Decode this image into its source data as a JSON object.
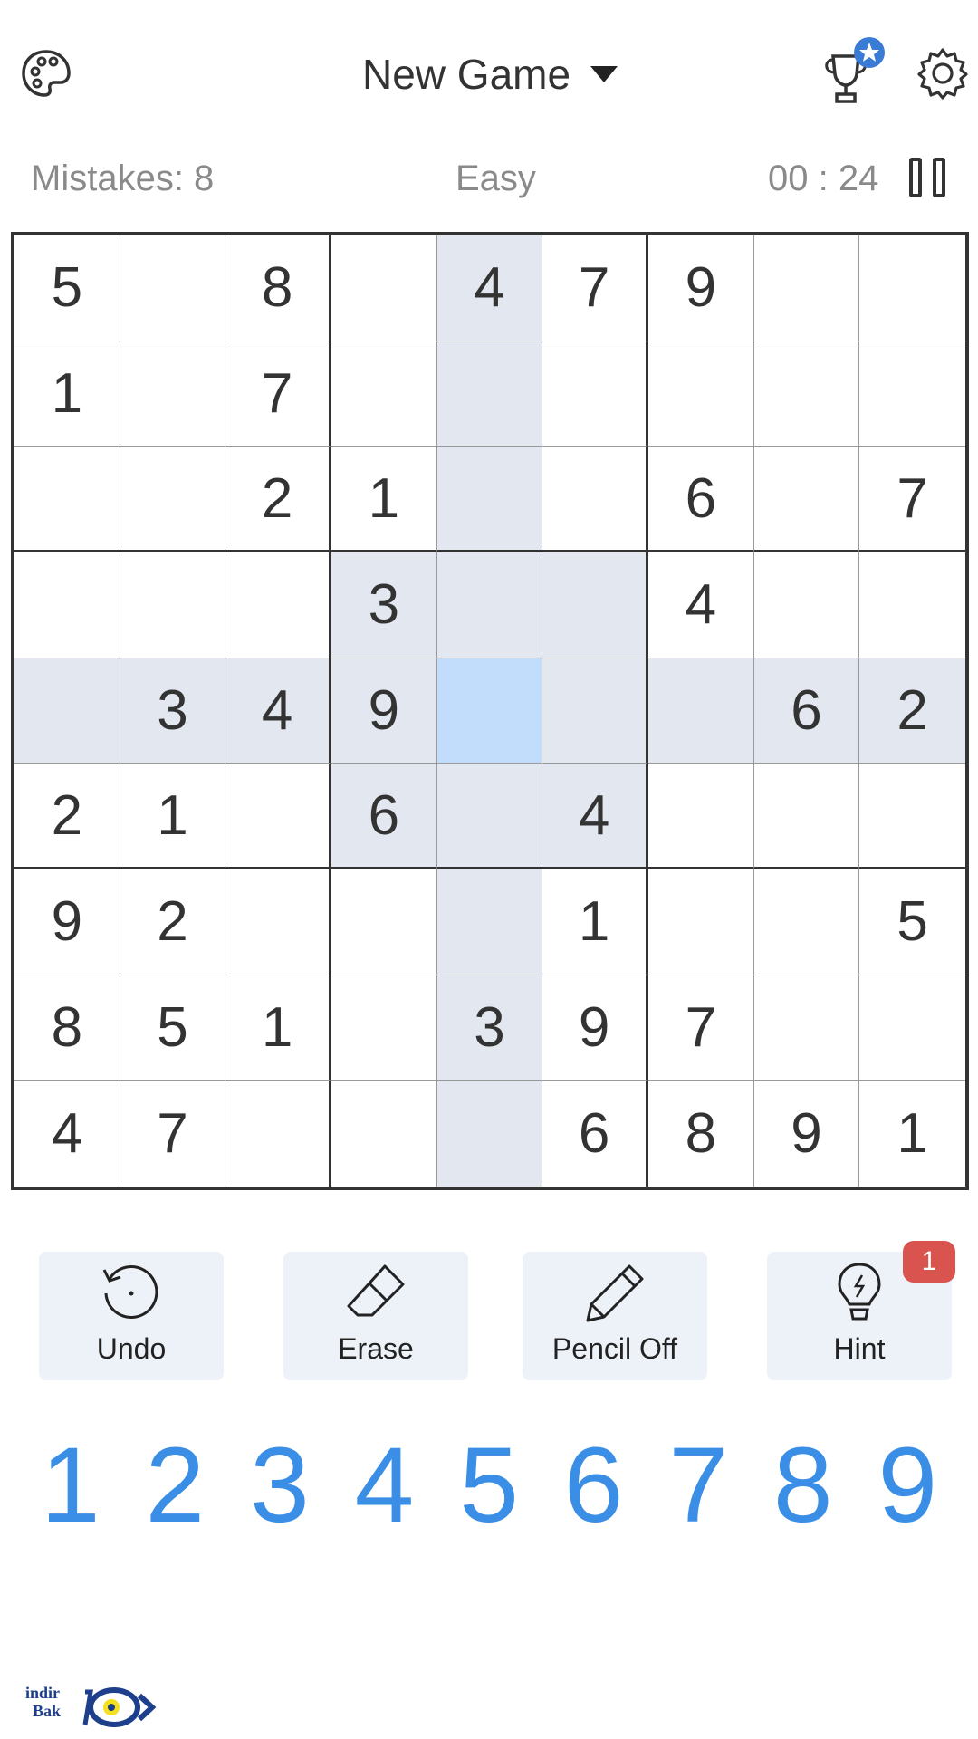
{
  "header": {
    "title": "New Game",
    "palette_icon": "palette-icon",
    "trophy_icon": "trophy-star-icon",
    "settings_icon": "gear-icon"
  },
  "status": {
    "mistakes": "Mistakes: 8",
    "difficulty": "Easy",
    "timer": "00 : 24"
  },
  "board": {
    "selected": [
      4,
      4
    ],
    "highlighted": [
      [
        0,
        4
      ],
      [
        1,
        4
      ],
      [
        2,
        4
      ],
      [
        3,
        4
      ],
      [
        5,
        4
      ],
      [
        6,
        4
      ],
      [
        7,
        4
      ],
      [
        8,
        4
      ],
      [
        4,
        0
      ],
      [
        4,
        1
      ],
      [
        4,
        2
      ],
      [
        4,
        3
      ],
      [
        4,
        5
      ],
      [
        4,
        6
      ],
      [
        4,
        7
      ],
      [
        4,
        8
      ],
      [
        3,
        3
      ],
      [
        3,
        5
      ],
      [
        5,
        3
      ],
      [
        5,
        5
      ]
    ],
    "grid": [
      [
        "5",
        "",
        "8",
        "",
        "4",
        "7",
        "9",
        "",
        ""
      ],
      [
        "1",
        "",
        "7",
        "",
        "",
        "",
        "",
        "",
        ""
      ],
      [
        "",
        "",
        "2",
        "1",
        "",
        "",
        "6",
        "",
        "7"
      ],
      [
        "",
        "",
        "",
        "3",
        "",
        "",
        "4",
        "",
        ""
      ],
      [
        "",
        "3",
        "4",
        "9",
        "",
        "",
        "",
        "6",
        "2"
      ],
      [
        "2",
        "1",
        "",
        "6",
        "",
        "4",
        "",
        "",
        ""
      ],
      [
        "9",
        "2",
        "",
        "",
        "",
        "1",
        "",
        "",
        "5"
      ],
      [
        "8",
        "5",
        "1",
        "",
        "3",
        "9",
        "7",
        "",
        ""
      ],
      [
        "4",
        "7",
        "",
        "",
        "",
        "6",
        "8",
        "9",
        "1"
      ]
    ]
  },
  "tools": {
    "undo": "Undo",
    "erase": "Erase",
    "pencil": "Pencil Off",
    "hint": "Hint",
    "hint_badge": "1"
  },
  "numpad": [
    "1",
    "2",
    "3",
    "4",
    "5",
    "6",
    "7",
    "8",
    "9"
  ],
  "watermark": {
    "line1": "indir",
    "line2": "Bak"
  },
  "colors": {
    "accent": "#3a8ee6",
    "highlight": "#e3e8f0",
    "selected": "#c2dcfb",
    "badge": "#d9534f"
  }
}
